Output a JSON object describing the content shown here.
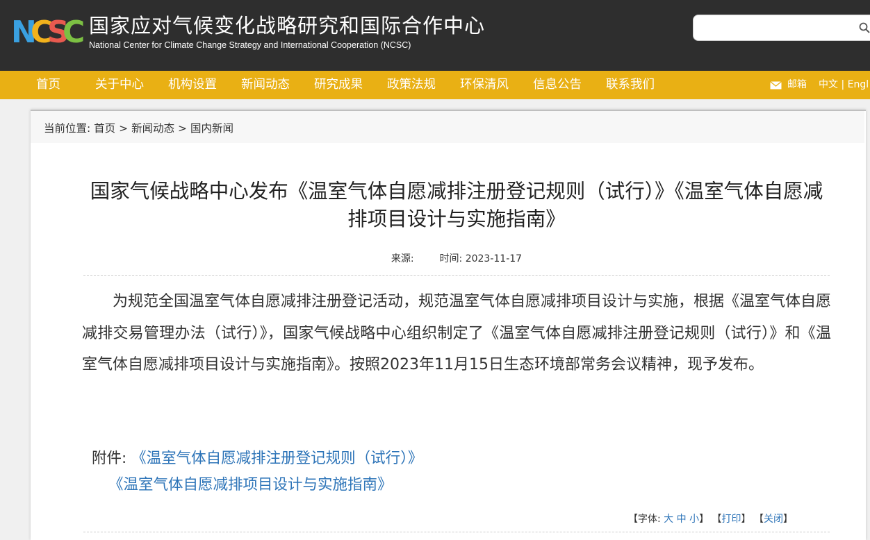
{
  "header": {
    "logo_letters": [
      "N",
      "C",
      "S",
      "C"
    ],
    "org_name_cn": "国家应对气候变化战略研究和国际合作中心",
    "org_name_en": "National Center for Climate Change Strategy and International Cooperation (NCSC)",
    "search_placeholder": "",
    "search_icon": "search-icon",
    "colors": {
      "background": "#2e2e2e",
      "logo_n": "#3aa0e0",
      "logo_c": "#f2b21c",
      "logo_s": "#e85a4f",
      "logo_c2": "#7cc043"
    }
  },
  "nav": {
    "background": "#e9b014",
    "items": [
      "首页",
      "关于中心",
      "机构设置",
      "新闻动态",
      "研究成果",
      "政策法规",
      "环保清风",
      "信息公告",
      "联系我们"
    ],
    "mail_label": "邮箱",
    "mail_icon": "mail-icon",
    "lang_label": "中文 | Engl"
  },
  "breadcrumb": {
    "prefix": "当前位置:",
    "items": [
      "首页",
      "新闻动态",
      "国内新闻"
    ],
    "separator": ">"
  },
  "article": {
    "title": "国家气候战略中心发布《温室气体自愿减排注册登记规则（试行）》《温室气体自愿减排项目设计与实施指南》",
    "source_label": "来源:",
    "source_value": "",
    "time_label": "时间:",
    "time_value": "2023-11-17",
    "body": "为规范全国温室气体自愿减排注册登记活动，规范温室气体自愿减排项目设计与实施，根据《温室气体自愿减排交易管理办法（试行）》，国家气候战略中心组织制定了《温室气体自愿减排注册登记规则（试行）》和《温室气体自愿减排项目设计与实施指南》。按照2023年11月15日生态环境部常务会议精神，现予发布。",
    "attachment_label": "附件:",
    "attachments": [
      "《温室气体自愿减排注册登记规则（试行）》",
      "《温室气体自愿减排项目设计与实施指南》"
    ],
    "link_color": "#2d74b8"
  },
  "tools": {
    "font_label": "【字体:",
    "font_large": "大",
    "font_medium": "中",
    "font_small": "小",
    "font_end": "】",
    "print_open": "【",
    "print": "打印",
    "print_close": "】",
    "close_open": "【",
    "close": "关闭",
    "close_close": "】"
  }
}
